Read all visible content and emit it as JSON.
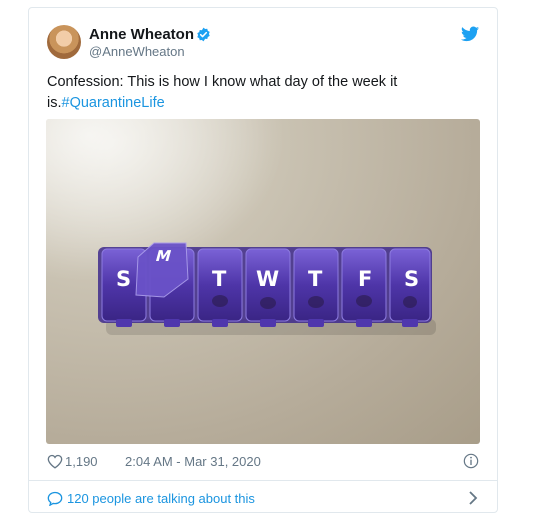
{
  "author": {
    "display_name": "Anne Wheaton",
    "handle": "@AnneWheaton"
  },
  "tweet": {
    "text": "Confession: This is how I know what day of the week it is.",
    "hashtag": "#QuarantineLife"
  },
  "photo": {
    "pill_box_letters": [
      "S",
      "M",
      "T",
      "W",
      "T",
      "F",
      "S"
    ]
  },
  "footer": {
    "likes": "1,190",
    "timestamp": "2:04 AM - Mar 31, 2020"
  },
  "conversation": {
    "text": "120 people are talking about this"
  },
  "colors": {
    "twitter_blue": "#1da1f2",
    "link_blue": "#1b95e0",
    "muted_gray": "#657786",
    "pill_purple": "#5b3fbf"
  }
}
